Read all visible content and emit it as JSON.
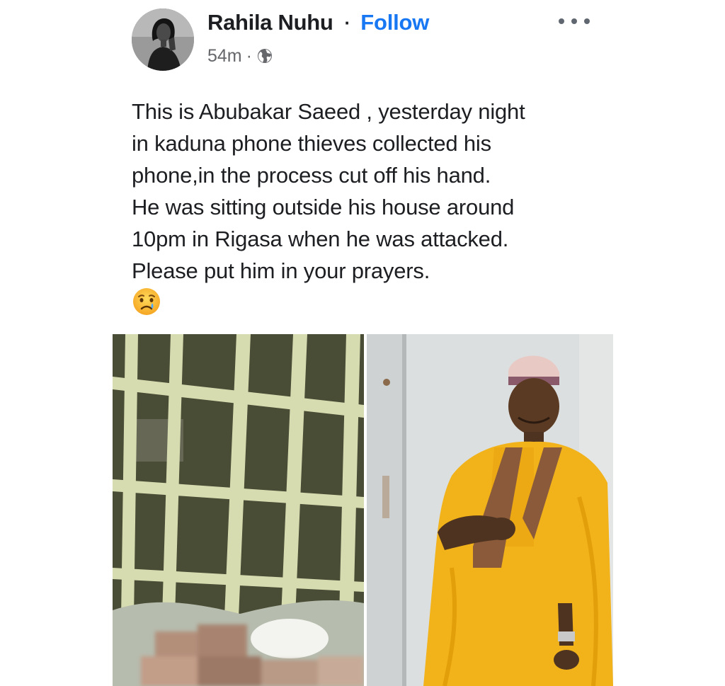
{
  "post": {
    "author": {
      "name": "Rahila Nuhu",
      "separator": "·",
      "follow_label": "Follow"
    },
    "meta": {
      "time": "54m",
      "separator": "·",
      "audience_icon": "globe-icon"
    },
    "more_icon": "more-options-icon",
    "text_lines": [
      "This is Abubakar Saeed , yesterday night",
      "in kaduna phone thieves collected his",
      "phone,in the process cut off his hand.",
      "He was sitting outside his house around",
      "10pm in Rigasa when he was attacked.",
      "Please put him in your prayers."
    ],
    "emoji": "crying-face-emoji",
    "photos": [
      {
        "icon": "photo-barred-window"
      },
      {
        "icon": "photo-man-in-yellow-attire"
      }
    ]
  },
  "colors": {
    "link": "#1877f2",
    "text": "#1c1e21",
    "meta": "#65676b",
    "robe": "#f2b21a"
  }
}
